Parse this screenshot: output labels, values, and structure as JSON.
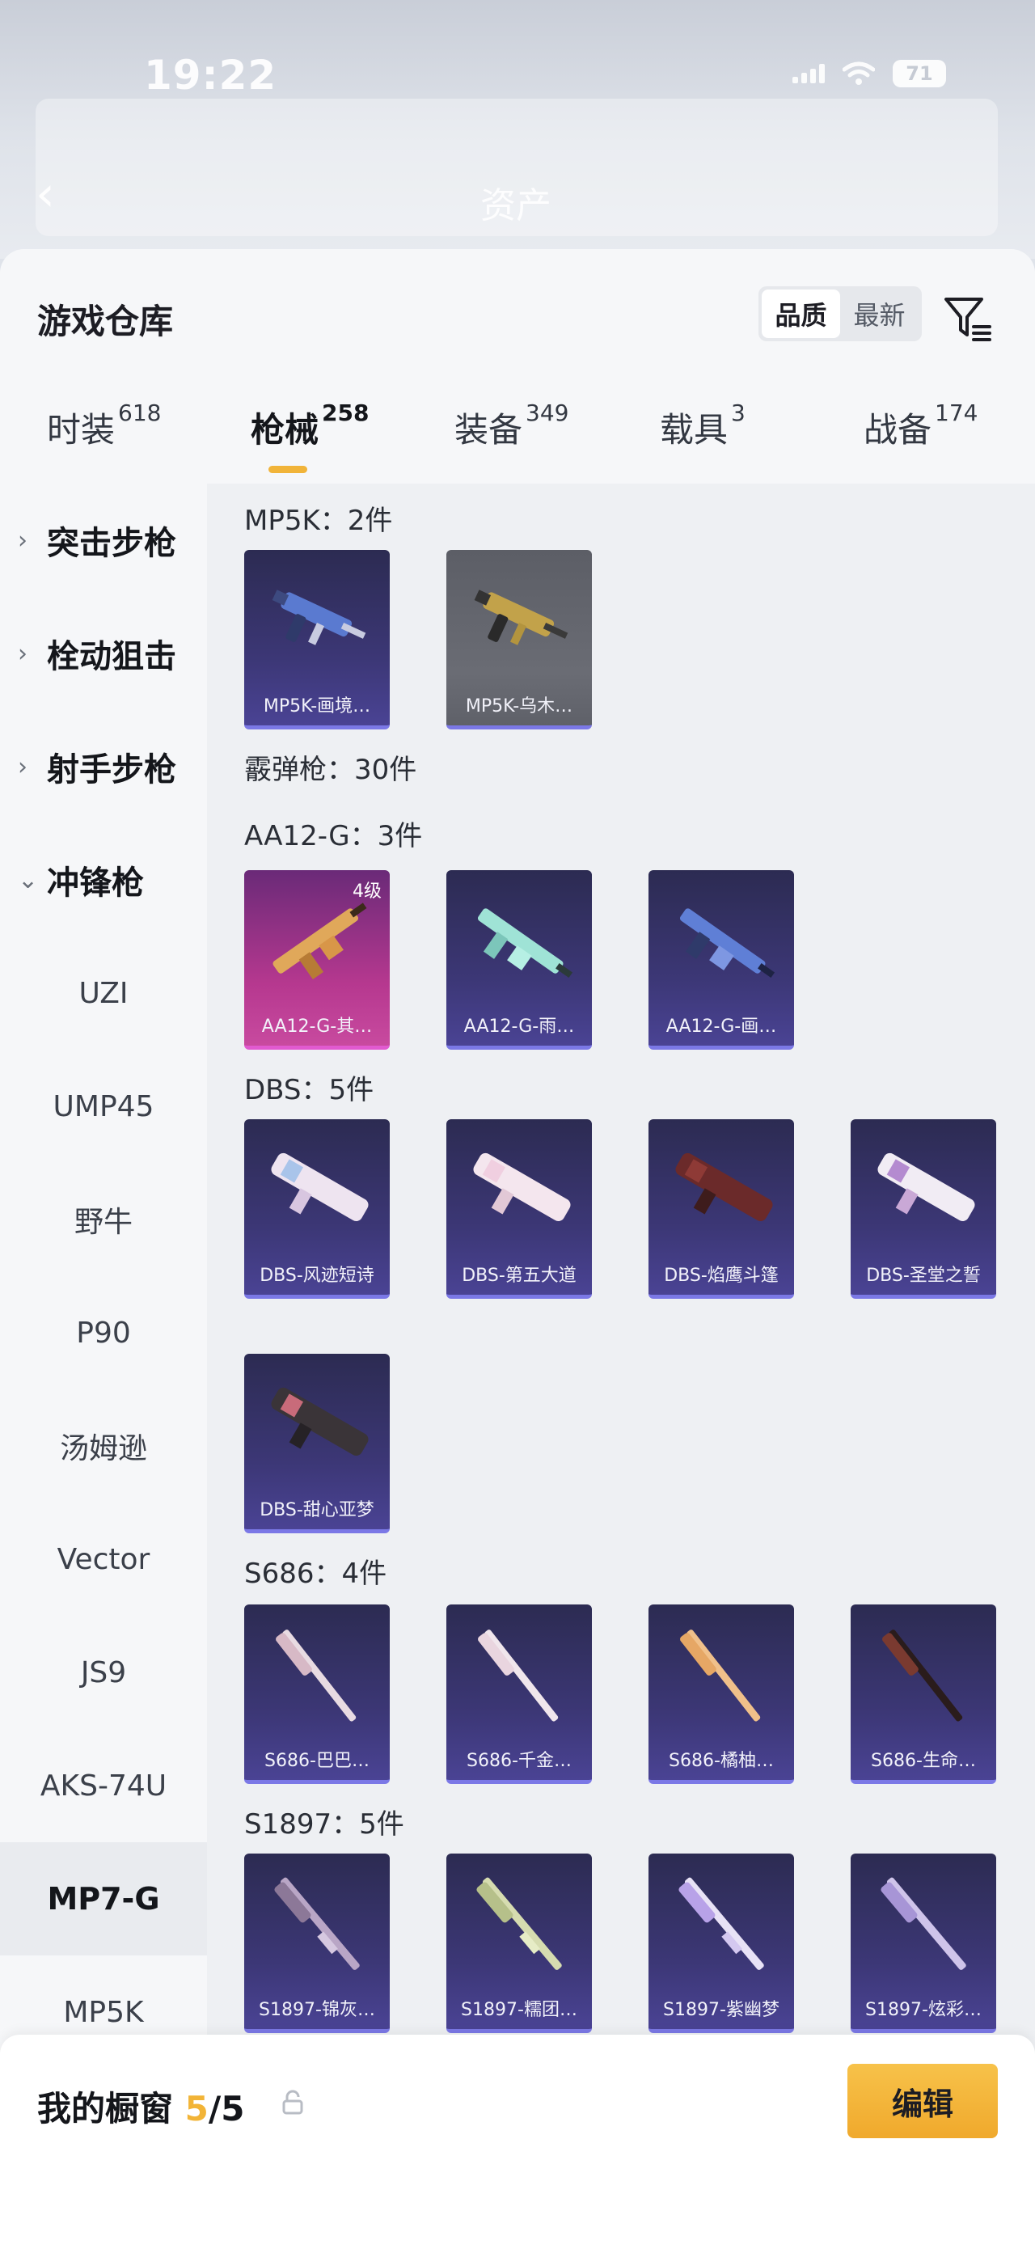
{
  "status_bar": {
    "time": "19:22",
    "battery": "71"
  },
  "background": {
    "title": "资产"
  },
  "sheet": {
    "title": "游戏仓库",
    "sort": [
      "品质",
      "最新"
    ],
    "filter_icon": "filter-icon"
  },
  "tabs": [
    {
      "label": "时装",
      "count": "618"
    },
    {
      "label": "枪械",
      "count": "258"
    },
    {
      "label": "装备",
      "count": "349"
    },
    {
      "label": "载具",
      "count": "3"
    },
    {
      "label": "战备",
      "count": "174"
    }
  ],
  "sidebar": {
    "categories": [
      "突击步枪",
      "栓动狙击",
      "射手步枪",
      "冲锋枪"
    ],
    "items": [
      "UZI",
      "UMP45",
      "野牛",
      "P90",
      "汤姆逊",
      "Vector",
      "JS9",
      "AKS-74U",
      "MP7-G",
      "MP5K"
    ]
  },
  "groups": {
    "mp5k": "MP5K：2件",
    "shotgun": "霰弹枪：30件",
    "aa12": "AA12-G：3件",
    "dbs": "DBS：5件",
    "s686": "S686：4件",
    "s1897": "S1897：5件"
  },
  "cards": {
    "mp5k": [
      "MP5K-画境…",
      "MP5K-乌木…"
    ],
    "aa12": [
      "AA12-G-其…",
      "AA12-G-雨…",
      "AA12-G-画…"
    ],
    "aa12_level": "4级",
    "dbs": [
      "DBS-风迹短诗",
      "DBS-第五大道",
      "DBS-焰鹰斗篷",
      "DBS-圣堂之誓",
      "DBS-甜心亚梦"
    ],
    "s686": [
      "S686-巴巴…",
      "S686-千金…",
      "S686-橘柚…",
      "S686-生命…"
    ],
    "s1897": [
      "S1897-锦灰…",
      "S1897-糯团…",
      "S1897-紫幽梦",
      "S1897-炫彩…"
    ]
  },
  "bottom": {
    "title": "我的橱窗",
    "count_current": "5",
    "count_total": "/5",
    "edit_label": "编辑"
  },
  "colors": {
    "accent": "#f2b437",
    "card_purple": "#3c3776",
    "card_pink": "#b6388f"
  }
}
